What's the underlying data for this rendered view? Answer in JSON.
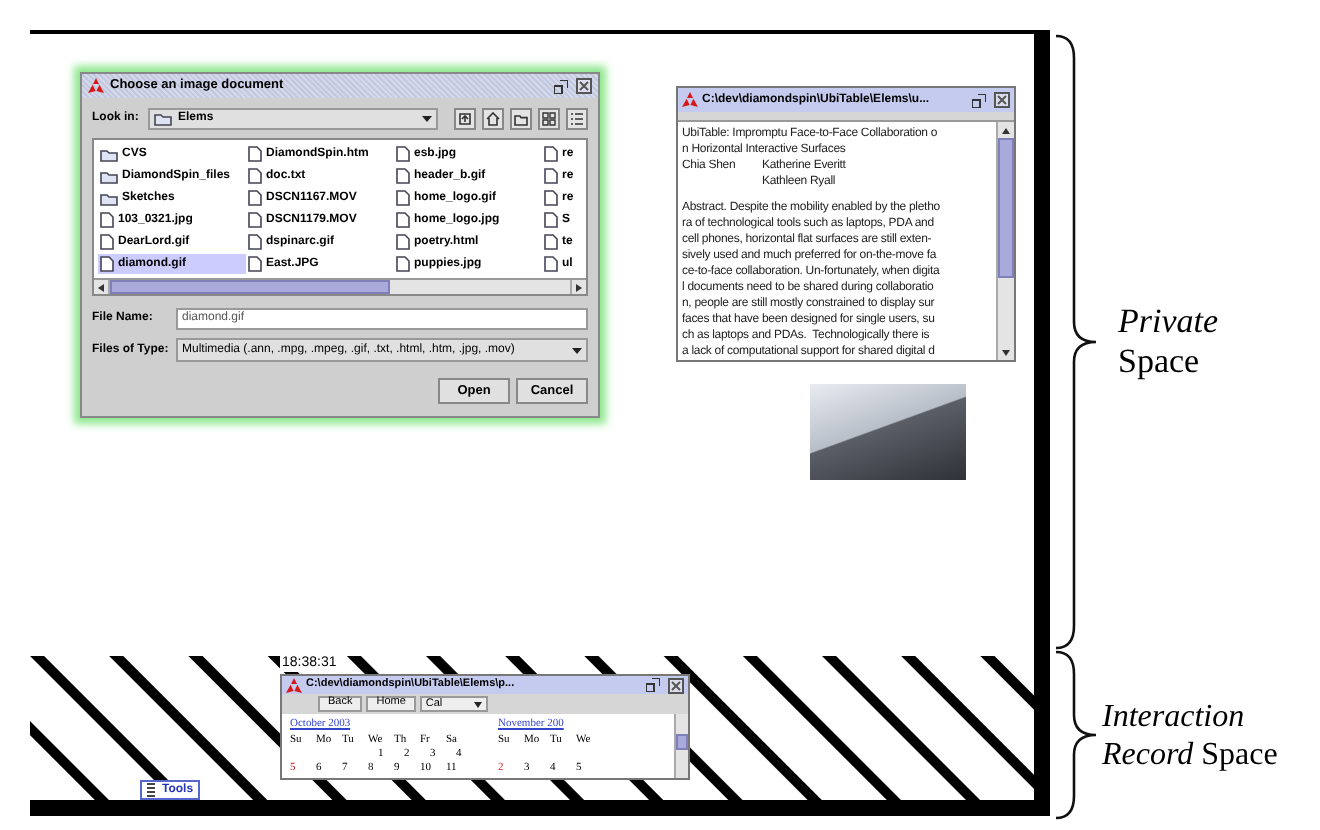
{
  "screen": {
    "file_dialog": {
      "title": "Choose an image document",
      "look_in": {
        "label": "Look in:",
        "value": "Elems"
      },
      "files": [
        {
          "name": "CVS",
          "kind": "folder",
          "selected": false
        },
        {
          "name": "DiamondSpin_files",
          "kind": "folder",
          "selected": false
        },
        {
          "name": "Sketches",
          "kind": "folder",
          "selected": false
        },
        {
          "name": "103_0321.jpg",
          "kind": "file",
          "selected": false
        },
        {
          "name": "DearLord.gif",
          "kind": "file",
          "selected": false
        },
        {
          "name": "diamond.gif",
          "kind": "file",
          "selected": true
        },
        {
          "name": "DiamondSpin.htm",
          "kind": "file",
          "selected": false
        },
        {
          "name": "doc.txt",
          "kind": "file",
          "selected": false
        },
        {
          "name": "DSCN1167.MOV",
          "kind": "file",
          "selected": false
        },
        {
          "name": "DSCN1179.MOV",
          "kind": "file",
          "selected": false
        },
        {
          "name": "dspinarc.gif",
          "kind": "file",
          "selected": false
        },
        {
          "name": "East.JPG",
          "kind": "file",
          "selected": false
        },
        {
          "name": "esb.jpg",
          "kind": "file",
          "selected": false
        },
        {
          "name": "header_b.gif",
          "kind": "file",
          "selected": false
        },
        {
          "name": "home_logo.gif",
          "kind": "file",
          "selected": false
        },
        {
          "name": "home_logo.jpg",
          "kind": "file",
          "selected": false
        },
        {
          "name": "poetry.html",
          "kind": "file",
          "selected": false
        },
        {
          "name": "puppies.jpg",
          "kind": "file",
          "selected": false
        },
        {
          "name": "re",
          "kind": "file",
          "selected": false
        },
        {
          "name": "re",
          "kind": "file",
          "selected": false
        },
        {
          "name": "re",
          "kind": "file",
          "selected": false
        },
        {
          "name": "S",
          "kind": "file",
          "selected": false
        },
        {
          "name": "te",
          "kind": "file",
          "selected": false
        },
        {
          "name": "ul",
          "kind": "file",
          "selected": false
        }
      ],
      "file_name": {
        "label": "File Name:",
        "value": "diamond.gif"
      },
      "file_type": {
        "label": "Files of Type:",
        "value": "Multimedia (.ann, .mpg, .mpeg, .gif, .txt, .html, .htm, .jpg, .mov)"
      },
      "buttons": [
        "Open",
        "Cancel"
      ]
    },
    "document_window": {
      "title": "C:\\dev\\diamondspin\\UbiTable\\Elems\\u...",
      "title_lines": [
        "UbiTable: Impromptu Face-to-Face Collaboration o",
        "n Horizontal Interactive Surfaces"
      ],
      "authors": [
        "Chia Shen",
        "Katherine Everitt",
        "Kathleen Ryall"
      ],
      "abstract_lines": [
        "Abstract. Despite the mobility enabled by the pletho",
        "ra of technological tools such as laptops, PDA and",
        "cell phones, horizontal flat surfaces are still exten-",
        "sively used and much preferred for on-the-move fa",
        "ce-to-face collaboration. Un-fortunately, when digita",
        "l documents need to be shared during collaboratio",
        "n, people are still mostly constrained to display sur",
        "faces that have been designed for single users, su",
        "ch as laptops and PDAs.  Technologically there is",
        "a lack of computational support for shared digital d"
      ]
    },
    "clock": "18:38:31",
    "calendar_window": {
      "title": "C:\\dev\\diamondspin\\UbiTable\\Elems\\p...",
      "toolbar": [
        {
          "label": "Back",
          "kind": "button"
        },
        {
          "label": "Home",
          "kind": "button"
        },
        {
          "label": "Cal",
          "kind": "dropdown"
        }
      ],
      "months": [
        {
          "title": "October 2003",
          "weekdays": [
            "Su",
            "Mo",
            "Tu",
            "We",
            "Th",
            "Fr",
            "Sa"
          ],
          "weeks": [
            {
              "days": [
                {
                  "day": "1",
                  "sunday": false
                },
                {
                  "day": "2",
                  "sunday": false
                },
                {
                  "day": "3",
                  "sunday": false
                },
                {
                  "day": "4",
                  "sunday": false
                }
              ]
            },
            {
              "days": [
                {
                  "day": "5",
                  "sunday": true
                },
                {
                  "day": "6",
                  "sunday": false
                },
                {
                  "day": "7",
                  "sunday": false
                },
                {
                  "day": "8",
                  "sunday": false
                },
                {
                  "day": "9",
                  "sunday": false
                },
                {
                  "day": "10",
                  "sunday": false
                },
                {
                  "day": "11",
                  "sunday": false
                }
              ]
            }
          ]
        },
        {
          "title": "November 200",
          "weekdays": [
            "Su",
            "Mo",
            "Tu",
            "We"
          ],
          "weeks": [
            {
              "days": [
                {
                  "day": "2",
                  "sunday": true
                },
                {
                  "day": "3",
                  "sunday": false
                },
                {
                  "day": "4",
                  "sunday": false
                },
                {
                  "day": "5",
                  "sunday": false
                }
              ]
            }
          ]
        }
      ]
    },
    "tools_tab": {
      "label": "Tools"
    }
  },
  "annotations": [
    {
      "label": "*Private* Space"
    },
    {
      "label": "*Interaction Record* Space"
    }
  ]
}
